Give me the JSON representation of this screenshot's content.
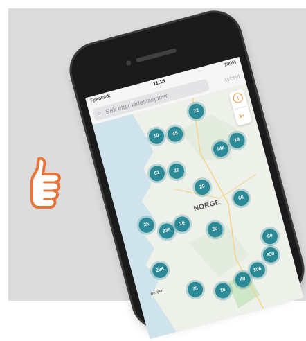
{
  "status": {
    "carrier": "Fjordkraft",
    "time": "11:15",
    "battery": "100%"
  },
  "search": {
    "placeholder": "Søk etter ladestasjoner",
    "cancel_label": "Avbryt"
  },
  "map": {
    "country_label": "NORGE",
    "city_label": "Bergen",
    "clusters": [
      "22",
      "10",
      "45",
      "146",
      "19",
      "61",
      "32",
      "20",
      "25",
      "235",
      "26",
      "66",
      "30",
      "236",
      "60",
      "75",
      "18",
      "40",
      "106",
      "650"
    ]
  },
  "colors": {
    "cluster": "#2c8a97",
    "accent": "#e8913a",
    "land": "#eef0ea",
    "water": "#cfe3ec",
    "thumb": "#e8743a"
  },
  "icons": [
    "search-icon",
    "info-icon",
    "location-arrow-icon",
    "thumbs-up-icon"
  ]
}
